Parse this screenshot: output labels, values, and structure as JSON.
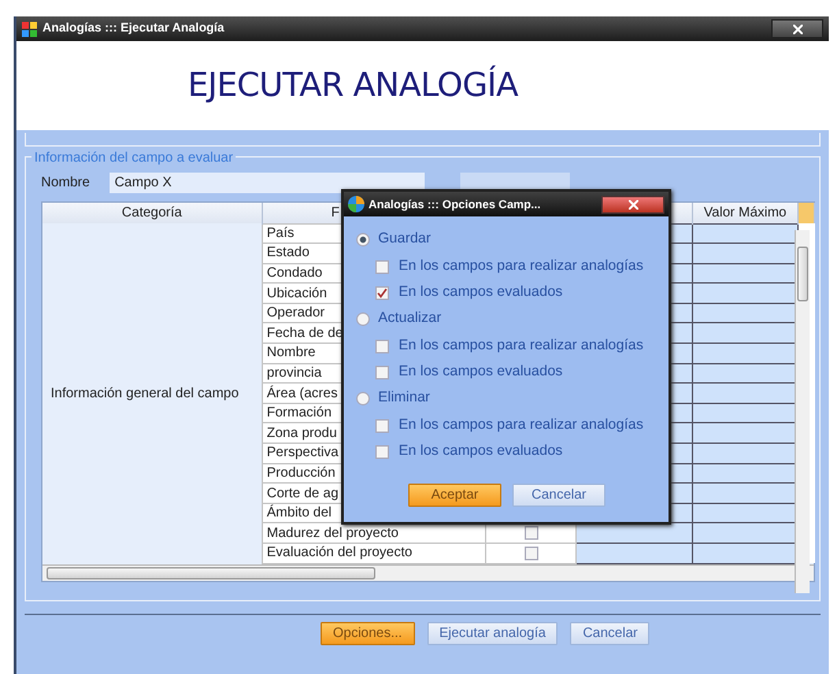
{
  "window": {
    "title": "Analogías ::: Ejecutar Analogía"
  },
  "heading": "EJECUTAR ANALOGÍA",
  "group": {
    "legend": "Información del campo a evaluar",
    "name_label": "Nombre",
    "name_value": "Campo X"
  },
  "table": {
    "columns": [
      "Categoría",
      "F",
      "Valor Máximo"
    ],
    "category": "Información general del campo",
    "rows": [
      {
        "field": "País"
      },
      {
        "field": "Estado"
      },
      {
        "field": "Condado"
      },
      {
        "field": "Ubicación"
      },
      {
        "field": "Operador"
      },
      {
        "field": "Fecha de de"
      },
      {
        "field": "Nombre"
      },
      {
        "field": "provincia"
      },
      {
        "field": "Área (acres"
      },
      {
        "field": "Formación"
      },
      {
        "field": "Zona produ"
      },
      {
        "field": "Perspectiva"
      },
      {
        "field": "Producción"
      },
      {
        "field": "Corte de ag"
      },
      {
        "field": "Ámbito del"
      },
      {
        "field": "Madurez del proyecto",
        "checked": false
      },
      {
        "field": "Evaluación del proyecto",
        "checked": false
      }
    ]
  },
  "buttons": [
    {
      "label": "Opciones...",
      "kind": "primary"
    },
    {
      "label": "Ejecutar analogía",
      "kind": "normal"
    },
    {
      "label": "Cancelar",
      "kind": "normal"
    }
  ],
  "dialog": {
    "title": "Analogías ::: Opciones Camp...",
    "options": [
      {
        "label": "Guardar",
        "selected": true,
        "targets": [
          {
            "label": "En los campos para realizar analogías",
            "checked": false
          },
          {
            "label": "En los campos evaluados",
            "checked": true
          }
        ]
      },
      {
        "label": "Actualizar",
        "selected": false,
        "targets": [
          {
            "label": "En los campos para realizar analogías",
            "checked": false
          },
          {
            "label": "En los campos evaluados",
            "checked": false
          }
        ]
      },
      {
        "label": "Eliminar",
        "selected": false,
        "targets": [
          {
            "label": "En los campos para realizar analogías",
            "checked": false
          },
          {
            "label": "En los campos evaluados",
            "checked": false
          }
        ]
      }
    ],
    "buttons": [
      {
        "label": "Aceptar",
        "kind": "primary"
      },
      {
        "label": "Cancelar",
        "kind": "normal"
      }
    ]
  }
}
